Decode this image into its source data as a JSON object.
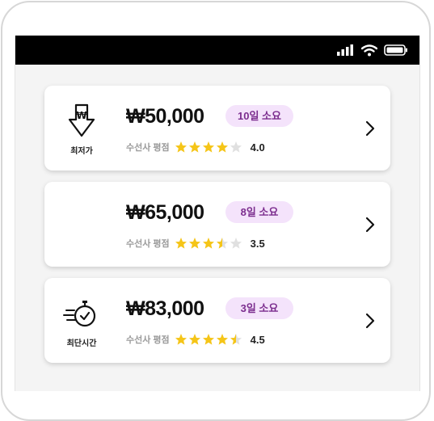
{
  "options": [
    {
      "icon": "lowest-price-icon",
      "tag": "최저가",
      "price": "₩50,000",
      "badge": "10일 소요",
      "rating_label": "수선사 평점",
      "rating": 4.0,
      "rating_text": "4.0"
    },
    {
      "icon": "",
      "tag": "",
      "price": "₩65,000",
      "badge": "8일 소요",
      "rating_label": "수선사 평점",
      "rating": 3.5,
      "rating_text": "3.5"
    },
    {
      "icon": "fastest-time-icon",
      "tag": "최단시간",
      "price": "₩83,000",
      "badge": "3일 소요",
      "rating_label": "수선사 평점",
      "rating": 4.5,
      "rating_text": "4.5"
    }
  ],
  "colors": {
    "star": "#f5c518",
    "star_empty": "#e0e0e0",
    "badge_bg": "#f4e3fb",
    "badge_text": "#7b2d8e"
  }
}
